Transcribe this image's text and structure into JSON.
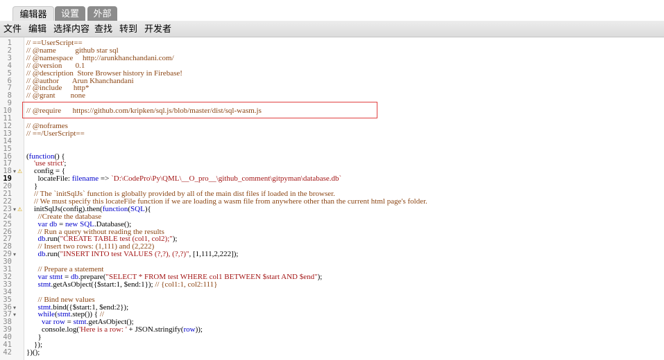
{
  "tabs": [
    {
      "label": "编辑器",
      "active": true
    },
    {
      "label": "设置",
      "active": false
    },
    {
      "label": "外部",
      "active": false
    }
  ],
  "menu": [
    "文件",
    "编辑",
    "选择内容",
    "查找",
    "转到",
    "开发者"
  ],
  "colors": {
    "comment": "#8b4513",
    "string": "#a31515",
    "keyword": "#0000cc",
    "highlight_box": "#e04040",
    "active_tab_bg": "#e6e6e6",
    "inactive_tab_bg": "#8c8c8c"
  },
  "editor": {
    "current_line": 19,
    "lines": [
      {
        "n": 1,
        "segs": [
          [
            "c",
            "// ==UserScript=="
          ]
        ]
      },
      {
        "n": 2,
        "segs": [
          [
            "c",
            "// @name          github star sql"
          ]
        ]
      },
      {
        "n": 3,
        "segs": [
          [
            "c",
            "// @namespace     http://arunkhanchandani.com/"
          ]
        ]
      },
      {
        "n": 4,
        "segs": [
          [
            "c",
            "// @version       0.1"
          ]
        ]
      },
      {
        "n": 5,
        "segs": [
          [
            "c",
            "// @description  Store Browser history in Firebase!"
          ]
        ]
      },
      {
        "n": 6,
        "segs": [
          [
            "c",
            "// @author       Arun Khanchandani"
          ]
        ]
      },
      {
        "n": 7,
        "segs": [
          [
            "c",
            "// @include      http*"
          ]
        ]
      },
      {
        "n": 8,
        "segs": [
          [
            "c",
            "// @grant        none"
          ]
        ]
      },
      {
        "n": 9,
        "segs": []
      },
      {
        "n": 10,
        "segs": [
          [
            "c",
            "// @require      https://github.com/kripken/sql.js/blob/master/dist/sql-wasm.js"
          ]
        ]
      },
      {
        "n": 11,
        "segs": []
      },
      {
        "n": 12,
        "segs": [
          [
            "c",
            "// @noframes"
          ]
        ]
      },
      {
        "n": 13,
        "segs": [
          [
            "c",
            "// ==/UserScript=="
          ]
        ]
      },
      {
        "n": 14,
        "segs": []
      },
      {
        "n": 15,
        "segs": []
      },
      {
        "n": 16,
        "segs": [
          [
            "p",
            "("
          ],
          [
            "k",
            "function"
          ],
          [
            "p",
            "() {"
          ]
        ]
      },
      {
        "n": 17,
        "segs": [
          [
            "p",
            "    "
          ],
          [
            "s",
            "'use strict'"
          ],
          [
            "p",
            ";"
          ]
        ]
      },
      {
        "n": 18,
        "fold": true,
        "warn": true,
        "segs": [
          [
            "p",
            "    config = {"
          ]
        ]
      },
      {
        "n": 19,
        "segs": [
          [
            "p",
            "      locateFile: "
          ],
          [
            "v",
            "filename"
          ],
          [
            "p",
            " => "
          ],
          [
            "s",
            "`D:\\CodePro\\Py\\QML\\__O_pro__\\github_comment\\gitpyman\\database.db`"
          ]
        ]
      },
      {
        "n": 20,
        "segs": [
          [
            "p",
            "    }"
          ]
        ]
      },
      {
        "n": 21,
        "segs": [
          [
            "c",
            "    // The `initSqlJs` function is globally provided by all of the main dist files if loaded in the browser."
          ]
        ]
      },
      {
        "n": 22,
        "segs": [
          [
            "c",
            "    // We must specify this locateFile function if we are loading a wasm file from anywhere other than the current html page's folder."
          ]
        ]
      },
      {
        "n": 23,
        "fold": true,
        "warn": true,
        "segs": [
          [
            "p",
            "    initSqlJs(config).then("
          ],
          [
            "k",
            "function"
          ],
          [
            "p",
            "("
          ],
          [
            "v",
            "SQL"
          ],
          [
            "p",
            "){"
          ]
        ]
      },
      {
        "n": 24,
        "segs": [
          [
            "c",
            "      //Create the database"
          ]
        ]
      },
      {
        "n": 25,
        "segs": [
          [
            "p",
            "      "
          ],
          [
            "k",
            "var"
          ],
          [
            "p",
            " "
          ],
          [
            "v",
            "db"
          ],
          [
            "p",
            " = "
          ],
          [
            "k",
            "new"
          ],
          [
            "p",
            " "
          ],
          [
            "v",
            "SQL"
          ],
          [
            "p",
            ".Database();"
          ]
        ]
      },
      {
        "n": 26,
        "segs": [
          [
            "c",
            "      // Run a query without reading the results"
          ]
        ]
      },
      {
        "n": 27,
        "segs": [
          [
            "p",
            "      "
          ],
          [
            "v",
            "db"
          ],
          [
            "p",
            ".run("
          ],
          [
            "s",
            "\"CREATE TABLE test (col1, col2);\""
          ],
          [
            "p",
            ");"
          ]
        ]
      },
      {
        "n": 28,
        "segs": [
          [
            "c",
            "      // Insert two rows: (1,111) and (2,222)"
          ]
        ]
      },
      {
        "n": 29,
        "fold": true,
        "segs": [
          [
            "p",
            "      "
          ],
          [
            "v",
            "db"
          ],
          [
            "p",
            ".run("
          ],
          [
            "s",
            "\"INSERT INTO test VALUES (?,?), (?,?)\""
          ],
          [
            "p",
            ", [1,111,2,222]);"
          ]
        ]
      },
      {
        "n": 30,
        "segs": []
      },
      {
        "n": 31,
        "segs": [
          [
            "c",
            "      // Prepare a statement"
          ]
        ]
      },
      {
        "n": 32,
        "segs": [
          [
            "p",
            "      "
          ],
          [
            "k",
            "var"
          ],
          [
            "p",
            " "
          ],
          [
            "v",
            "stmt"
          ],
          [
            "p",
            " = "
          ],
          [
            "v",
            "db"
          ],
          [
            "p",
            ".prepare("
          ],
          [
            "s",
            "\"SELECT * FROM test WHERE col1 BETWEEN $start AND $end\""
          ],
          [
            "p",
            ");"
          ]
        ]
      },
      {
        "n": 33,
        "segs": [
          [
            "p",
            "      "
          ],
          [
            "v",
            "stmt"
          ],
          [
            "p",
            ".getAsObject({$start:1, $end:1}); "
          ],
          [
            "c",
            "// {col1:1, col2:111}"
          ]
        ]
      },
      {
        "n": 34,
        "segs": []
      },
      {
        "n": 35,
        "segs": [
          [
            "c",
            "      // Bind new values"
          ]
        ]
      },
      {
        "n": 36,
        "fold": true,
        "segs": [
          [
            "p",
            "      "
          ],
          [
            "v",
            "stmt"
          ],
          [
            "p",
            ".bind({$start:1, $end:2});"
          ]
        ]
      },
      {
        "n": 37,
        "fold": true,
        "segs": [
          [
            "p",
            "      "
          ],
          [
            "k",
            "while"
          ],
          [
            "p",
            "("
          ],
          [
            "v",
            "stmt"
          ],
          [
            "p",
            ".step()) { "
          ],
          [
            "c",
            "//"
          ]
        ]
      },
      {
        "n": 38,
        "segs": [
          [
            "p",
            "        "
          ],
          [
            "k",
            "var"
          ],
          [
            "p",
            " "
          ],
          [
            "v",
            "row"
          ],
          [
            "p",
            " = "
          ],
          [
            "v",
            "stmt"
          ],
          [
            "p",
            ".getAsObject();"
          ]
        ]
      },
      {
        "n": 39,
        "segs": [
          [
            "p",
            "        console.log("
          ],
          [
            "s",
            "'Here is a row: '"
          ],
          [
            "p",
            " + JSON.stringify("
          ],
          [
            "v",
            "row"
          ],
          [
            "p",
            "));"
          ]
        ]
      },
      {
        "n": 40,
        "segs": [
          [
            "p",
            "      }"
          ]
        ]
      },
      {
        "n": 41,
        "segs": [
          [
            "p",
            "    });"
          ]
        ]
      },
      {
        "n": 42,
        "segs": [
          [
            "p",
            "})();"
          ]
        ]
      }
    ]
  }
}
